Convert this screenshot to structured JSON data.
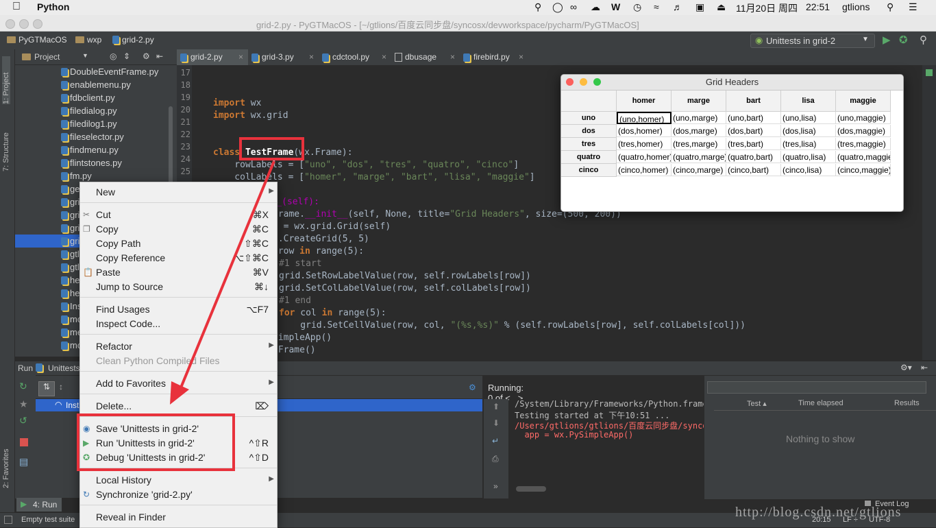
{
  "menubar": {
    "app_name": "Python",
    "date": "11月20日 周四",
    "time": "22:51",
    "user": "gtlions"
  },
  "window": {
    "title": "grid-2.py - PyGTMacOS - [~/gtlions/百度云同步盘/syncosx/devworkspace/pycharm/PyGTMacOS]"
  },
  "navbar": {
    "crumbs": [
      "PyGTMacOS",
      "wxp",
      "grid-2.py"
    ],
    "run_config": "Unittests in grid-2"
  },
  "sidebar": {
    "tab_project": "1: Project",
    "tab_structure": "7: Structure",
    "tab_favorites": "2: Favorites",
    "header": "Project"
  },
  "project_files": [
    "DoubleEventFrame.py",
    "enablemenu.py",
    "fdbclient.py",
    "filedialog.py",
    "filedilog1.py",
    "fileselector.py",
    "findmenu.py",
    "flintstones.py",
    "fm.py",
    "ge",
    "gri",
    "gri",
    "gri",
    "gri",
    "gtl",
    "gtl",
    "he",
    "he",
    "Ins",
    "mo",
    "me",
    "mo"
  ],
  "editor": {
    "tabs": [
      "grid-2.py",
      "grid-3.py",
      "cdctool.py",
      "dbusage",
      "firebird.py"
    ],
    "line_numbers": [
      "17",
      "18",
      "19",
      "20",
      "21",
      "22",
      "23",
      "24",
      "25"
    ],
    "code": {
      "import1_kw": "import",
      "import1_mod": " wx",
      "import2_kw": "import",
      "import2_mod": " wx.grid",
      "class_kw": "class ",
      "class_name": "TestFrame",
      "class_base": "(wx.Frame):",
      "row_labels_a": "    rowLabels = [",
      "row_labels_b": "\"uno\", \"dos\", \"tres\", \"quatro\", \"cinco\"",
      "row_labels_c": "]",
      "col_labels_a": "    colLabels = [",
      "col_labels_b": "\"homer\", \"marge\", \"bart\", \"lisa\", \"maggie\"",
      "col_labels_c": "]",
      "l27": "nit__(self):",
      "l28a": "Frame.",
      "l28b": "__init__",
      "l28c": "(self, None, title=",
      "l28d": "\"Grid Headers\"",
      "l28e": ", size=(500, 200))",
      "l29": "d = wx.grid.Grid(self)",
      "l30": "d.CreateGrid(5, 5)",
      "l31a": " row ",
      "l31b": "in",
      "l31c": " range(5):",
      "l32": "#1 start",
      "l33": "grid.SetRowLabelValue(row, self.rowLabels[row])",
      "l34": "grid.SetColLabelValue(row, self.colLabels[row])",
      "l35": "#1 end",
      "l36a": "for",
      "l36b": " col ",
      "l36c": "in",
      "l36d": " range(5):",
      "l37a": "    grid.SetCellValue(row, col, ",
      "l37b": "\"(%s,%s)\"",
      "l37c": " % (self.rowLabels[row], self.colLabels[col]))",
      "l38": "SimpleApp()",
      "l39": "tFrame()"
    }
  },
  "grid_window": {
    "title": "Grid Headers",
    "columns": [
      "homer",
      "marge",
      "bart",
      "lisa",
      "maggie"
    ],
    "rows": [
      "uno",
      "dos",
      "tres",
      "quatro",
      "cinco"
    ],
    "cells": [
      [
        "(uno,homer)",
        "(uno,marge)",
        "(uno,bart)",
        "(uno,lisa)",
        "(uno,maggie)"
      ],
      [
        "(dos,homer)",
        "(dos,marge)",
        "(dos,bart)",
        "(dos,lisa)",
        "(dos,maggie)"
      ],
      [
        "(tres,homer)",
        "(tres,marge)",
        "(tres,bart)",
        "(tres,lisa)",
        "(tres,maggie)"
      ],
      [
        "(quatro,homer)",
        "(quatro,marge)",
        "(quatro,bart)",
        "(quatro,lisa)",
        "(quatro,maggie)"
      ],
      [
        "(cinco,homer)",
        "(cinco,marge)",
        "(cinco,bart)",
        "(cinco,lisa)",
        "(cinco,maggie)"
      ]
    ]
  },
  "context_menu": {
    "items": [
      {
        "label": "New",
        "shortcut": "",
        "submenu": true,
        "disabled": false
      },
      {
        "label": "Cut",
        "shortcut": "⌘X",
        "submenu": false,
        "disabled": false
      },
      {
        "label": "Copy",
        "shortcut": "⌘C",
        "submenu": false,
        "disabled": false
      },
      {
        "label": "Copy Path",
        "shortcut": "⇧⌘C",
        "submenu": false,
        "disabled": false
      },
      {
        "label": "Copy Reference",
        "shortcut": "⌥⇧⌘C",
        "submenu": false,
        "disabled": false
      },
      {
        "label": "Paste",
        "shortcut": "⌘V",
        "submenu": false,
        "disabled": false
      },
      {
        "label": "Jump to Source",
        "shortcut": "⌘↓",
        "submenu": false,
        "disabled": false
      },
      {
        "label": "Find Usages",
        "shortcut": "⌥F7",
        "submenu": false,
        "disabled": false
      },
      {
        "label": "Inspect Code...",
        "shortcut": "",
        "submenu": false,
        "disabled": false
      },
      {
        "label": "Refactor",
        "shortcut": "",
        "submenu": true,
        "disabled": false
      },
      {
        "label": "Clean Python Compiled Files",
        "shortcut": "",
        "submenu": false,
        "disabled": true
      },
      {
        "label": "Add to Favorites",
        "shortcut": "",
        "submenu": true,
        "disabled": false
      },
      {
        "label": "Delete...",
        "shortcut": "⌦",
        "submenu": false,
        "disabled": false
      },
      {
        "label": "Save 'Unittests in grid-2'",
        "shortcut": "",
        "submenu": false,
        "disabled": false
      },
      {
        "label": "Run 'Unittests in grid-2'",
        "shortcut": "^⇧R",
        "submenu": false,
        "disabled": false
      },
      {
        "label": "Debug 'Unittests in grid-2'",
        "shortcut": "^⇧D",
        "submenu": false,
        "disabled": false
      },
      {
        "label": "Local History",
        "shortcut": "",
        "submenu": true,
        "disabled": false
      },
      {
        "label": "Synchronize 'grid-2.py'",
        "shortcut": "",
        "submenu": false,
        "disabled": false
      },
      {
        "label": "Reveal in Finder",
        "shortcut": "",
        "submenu": false,
        "disabled": false
      }
    ]
  },
  "run_panel": {
    "header": "Run",
    "config": "Unittests",
    "running": "Running: 0 of <...>",
    "selected_node": "Inst",
    "console_lines": [
      "/System/Library/Frameworks/Python.frame",
      "Testing started at 下午10:51 ...",
      "/Users/gtlions/gtlions/百度云同步盘/synco",
      "  app = wx.PySimpleApp()"
    ],
    "test_columns": [
      "Test ▴",
      "Time elapsed",
      "Results"
    ],
    "empty_text": "Nothing to show",
    "run_tab": "4: Run"
  },
  "statusbar": {
    "message": "Empty test suite",
    "position": "20:15",
    "line_sep": "LF ÷",
    "encoding": "UTF-8",
    "event_log": "Event Log"
  },
  "watermark": "http://blog.csdn.net/gtlions",
  "colors": {
    "accent_red": "#e8323c",
    "selection_blue": "#2f65ca"
  }
}
